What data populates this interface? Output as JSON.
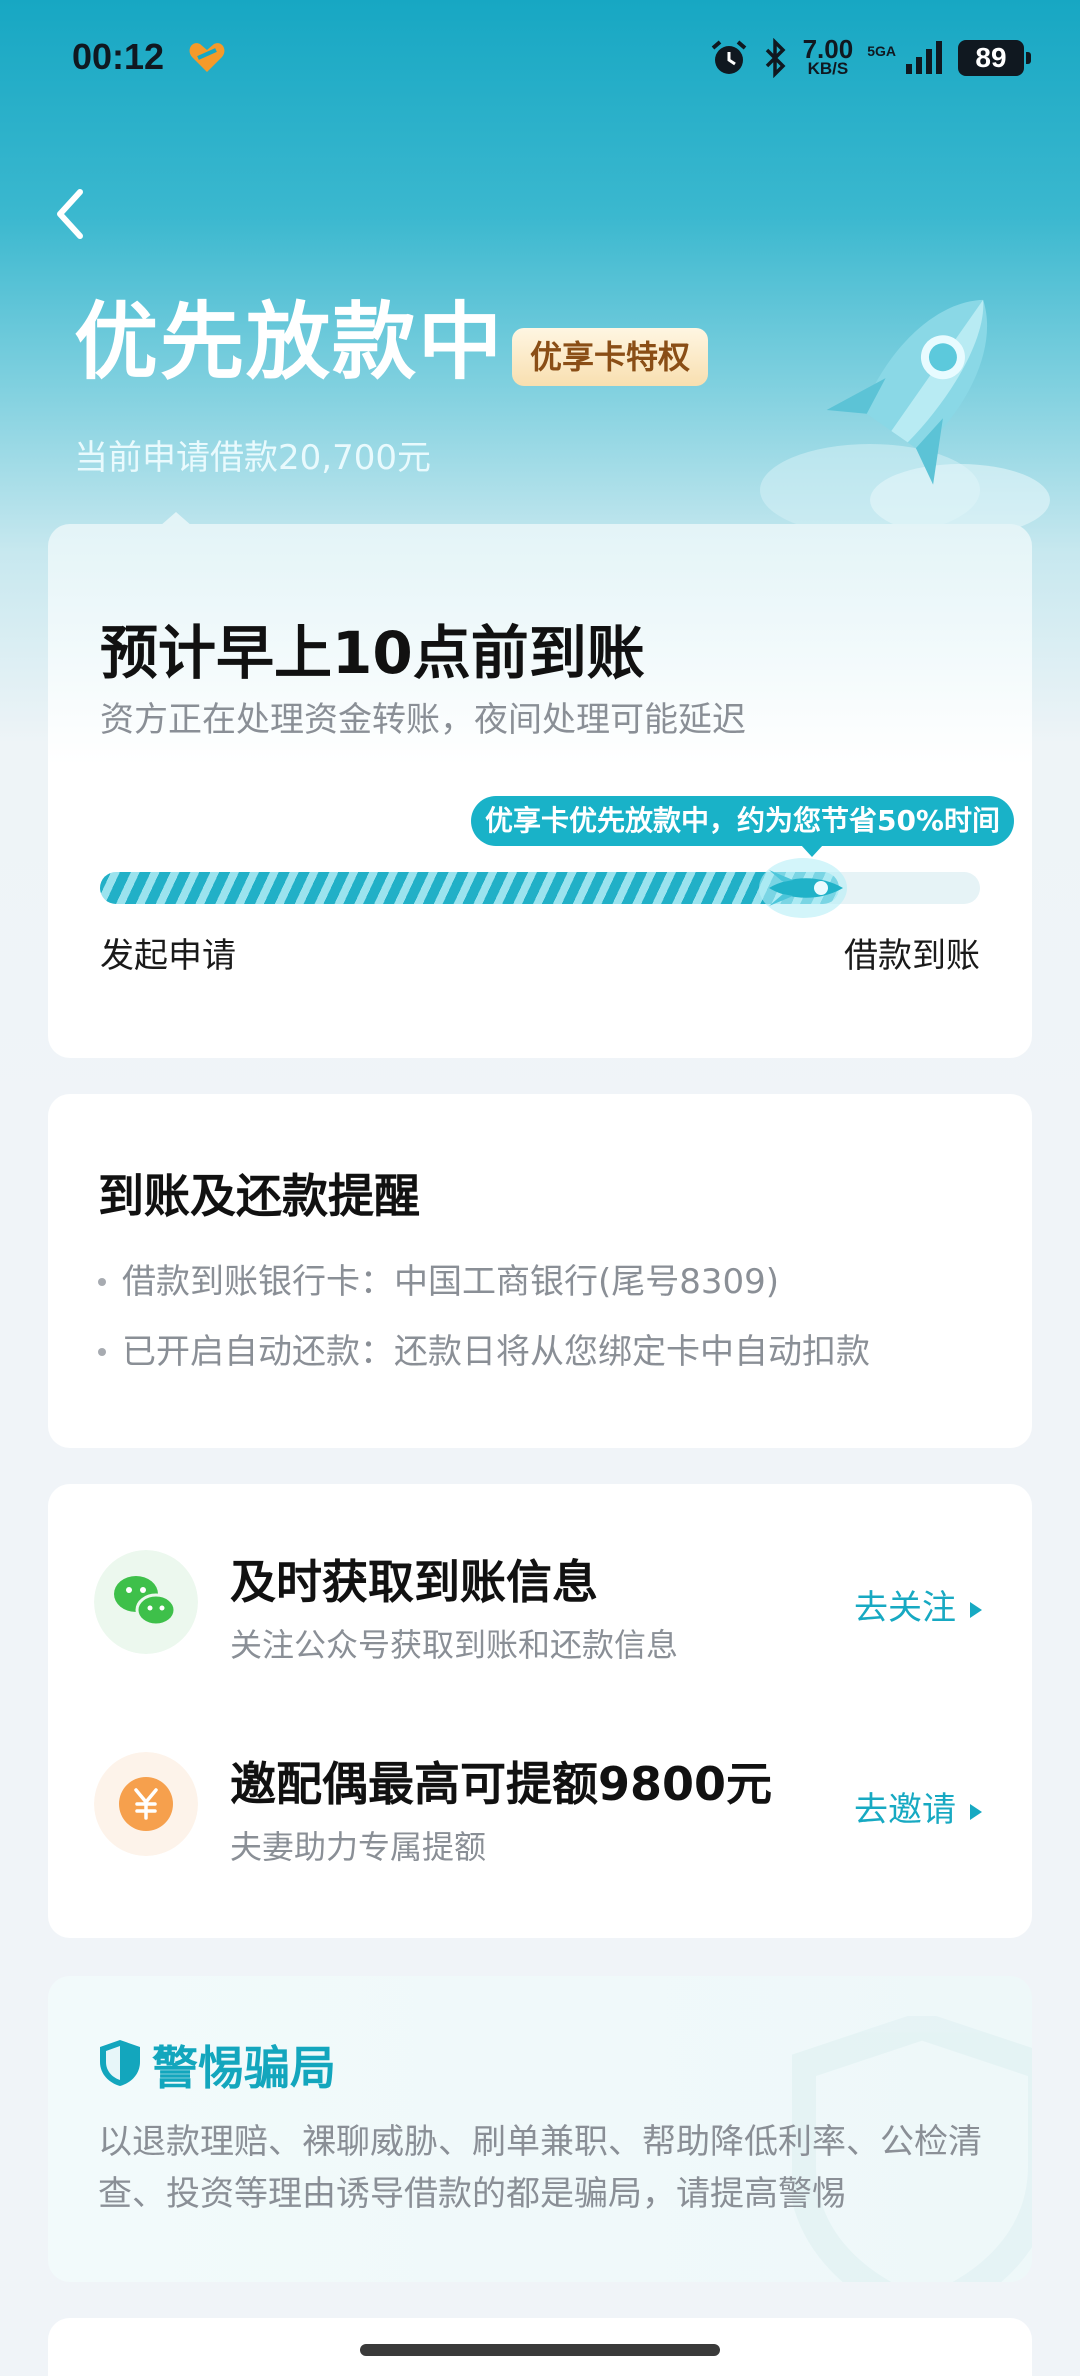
{
  "status_bar": {
    "time": "00:12",
    "net_speed_value": "7.00",
    "net_speed_unit": "KB/S",
    "network": "5GA",
    "battery": "89",
    "icons": [
      "heart-icon",
      "alarm-icon",
      "bluetooth-icon",
      "signal-icon",
      "battery-icon"
    ]
  },
  "header": {
    "title": "优先放款中",
    "badge": "优享卡特权",
    "subtitle": "当前申请借款20,700元"
  },
  "progress_card": {
    "eta_title": "预计早上10点前到账",
    "eta_subtitle": "资方正在处理资金转账，夜间处理可能延迟",
    "tip": "优享卡优先放款中，约为您节省50%时间",
    "progress": 0.84,
    "step_start": "发起申请",
    "step_end": "借款到账"
  },
  "reminder_card": {
    "title": "到账及还款提醒",
    "lines": [
      "借款到账银行卡：中国工商银行(尾号8309)",
      "已开启自动还款：还款日将从您绑定卡中自动扣款"
    ]
  },
  "actions_card": {
    "items": [
      {
        "title": "及时获取到账信息",
        "subtitle": "关注公众号获取到账和还款信息",
        "link": "去关注",
        "icon": "wechat-icon"
      },
      {
        "title": "邀配偶最高可提额9800元",
        "subtitle": "夫妻助力专属提额",
        "link": "去邀请",
        "icon": "yuan-coin-icon"
      }
    ]
  },
  "warning_card": {
    "title": "警惕骗局",
    "body": "以退款理赔、裸聊威胁、刷单兼职、帮助降低利率、公检清查、投资等理由诱导借款的都是骗局，请提高警惕"
  },
  "colors": {
    "accent": "#17a9c2",
    "hero_top": "#17a7c3",
    "badge_text": "#8a4e16",
    "wechat_green": "#3ec04a",
    "coin_orange": "#f6a04d"
  }
}
